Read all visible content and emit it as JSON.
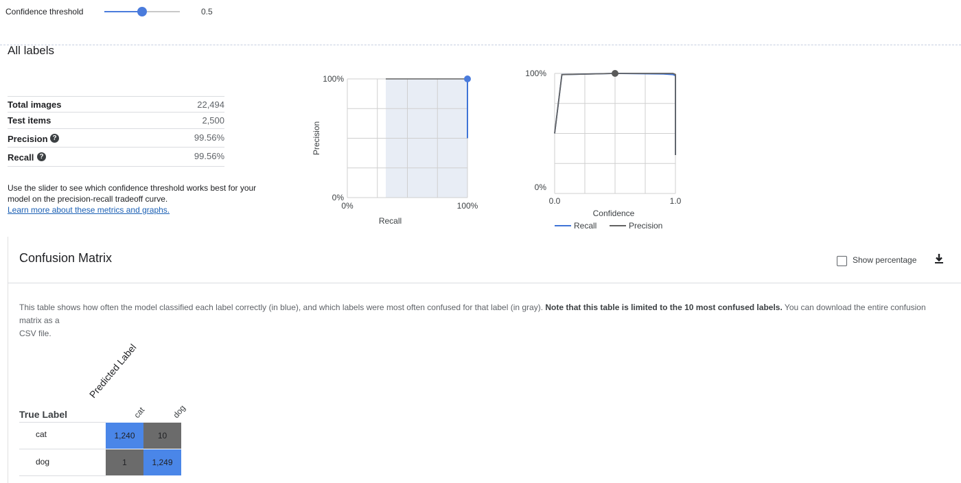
{
  "threshold": {
    "label": "Confidence threshold",
    "value": "0.5",
    "fraction": 0.5
  },
  "section_title": "All labels",
  "metrics": [
    {
      "label": "Total images",
      "value": "22,494",
      "help": false
    },
    {
      "label": "Test items",
      "value": "2,500",
      "help": false
    },
    {
      "label": "Precision",
      "value": "99.56%",
      "help": true
    },
    {
      "label": "Recall",
      "value": "99.56%",
      "help": true
    }
  ],
  "help_text": "Use the slider to see which confidence threshold works best for your model on the precision-recall tradeoff curve.",
  "help_text_line1": "Use the slider to see which confidence threshold works best for your",
  "help_text_line2": "model on the precision-recall tradeoff curve.",
  "learn_more": "Learn more about these metrics and graphs.",
  "chart_data": [
    {
      "type": "line",
      "xlabel": "Recall",
      "ylabel": "Precision",
      "x_ticks": [
        "0%",
        "100%"
      ],
      "y_ticks": [
        "0%",
        "100%"
      ],
      "series": [
        {
          "x": [
            1.0,
            1.0,
            0.32
          ],
          "y": [
            0.5,
            1.0,
            1.0
          ]
        }
      ],
      "highlight_point": {
        "x": 1.0,
        "y": 1.0
      },
      "colors": {
        "line": "#3e73d6",
        "area": "#e8edf5",
        "point": "#4a7bdc"
      }
    },
    {
      "type": "line",
      "xlabel": "Confidence",
      "x_ticks": [
        "0.0",
        "1.0"
      ],
      "y_ticks": [
        "0%",
        "100%"
      ],
      "series": [
        {
          "name": "Recall",
          "color": "#3e73d6",
          "x": [
            0.0,
            0.06,
            0.5,
            0.9,
            0.98,
            1.0,
            1.0
          ],
          "y": [
            0.5,
            0.99,
            1.0,
            0.995,
            0.99,
            0.98,
            0.32
          ]
        },
        {
          "name": "Precision",
          "color": "#616161",
          "x": [
            0.0,
            0.06,
            0.5,
            0.9,
            0.98,
            1.0,
            1.0
          ],
          "y": [
            0.5,
            0.99,
            1.0,
            1.0,
            1.0,
            0.99,
            0.32
          ]
        }
      ],
      "highlight_point": {
        "x": 0.5,
        "y": 1.0
      }
    }
  ],
  "confusion": {
    "title": "Confusion Matrix",
    "show_percentage": "Show percentage",
    "description_part1": "This table shows how often the model classified each label correctly (in blue), and which labels were most often confused for that label (in gray). ",
    "description_bold": "Note that this table is limited to the 10 most confused labels.",
    "description_part2": " You can download the entire confusion matrix as a",
    "description_line2": "CSV file.",
    "true_label": "True Label",
    "predicted_label": "Predicted Label",
    "columns": [
      "cat",
      "dog"
    ],
    "rows": [
      {
        "label": "cat",
        "cells": [
          "1,240",
          "10"
        ]
      },
      {
        "label": "dog",
        "cells": [
          "1",
          "1,249"
        ]
      }
    ],
    "colors": {
      "correct": "#4a86e8",
      "confused": "#6b6b6b"
    }
  }
}
